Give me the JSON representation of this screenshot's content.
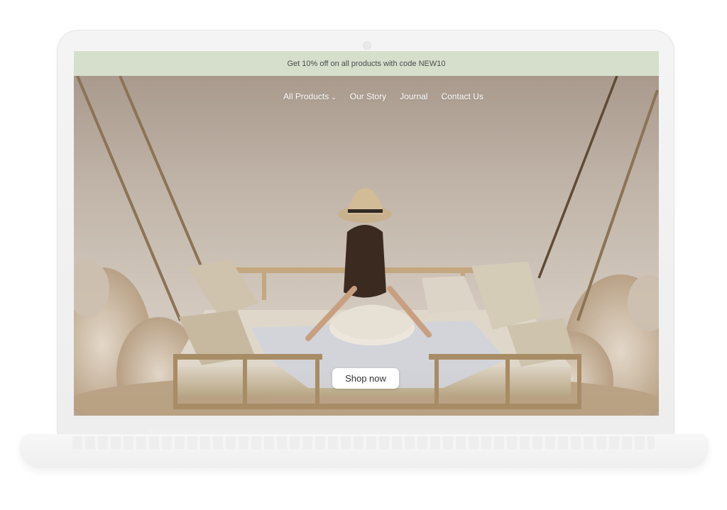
{
  "announcement": {
    "text": "Get 10% off on all products with code NEW10"
  },
  "nav": {
    "items": [
      {
        "label": "All Products",
        "has_dropdown": true
      },
      {
        "label": "Our Story"
      },
      {
        "label": "Journal"
      },
      {
        "label": "Contact Us"
      }
    ]
  },
  "hero": {
    "cta_label": "Shop now",
    "image_description": "Woman in straw hat sitting on a hanging rope daybed with cushions over a field of pampas grass"
  },
  "colors": {
    "announcement_bg": "#d5dfcc",
    "hero_sky": "#c7bcb0",
    "cta_bg": "#ffffff"
  },
  "icons": {
    "dropdown": "chevron-down-icon"
  }
}
